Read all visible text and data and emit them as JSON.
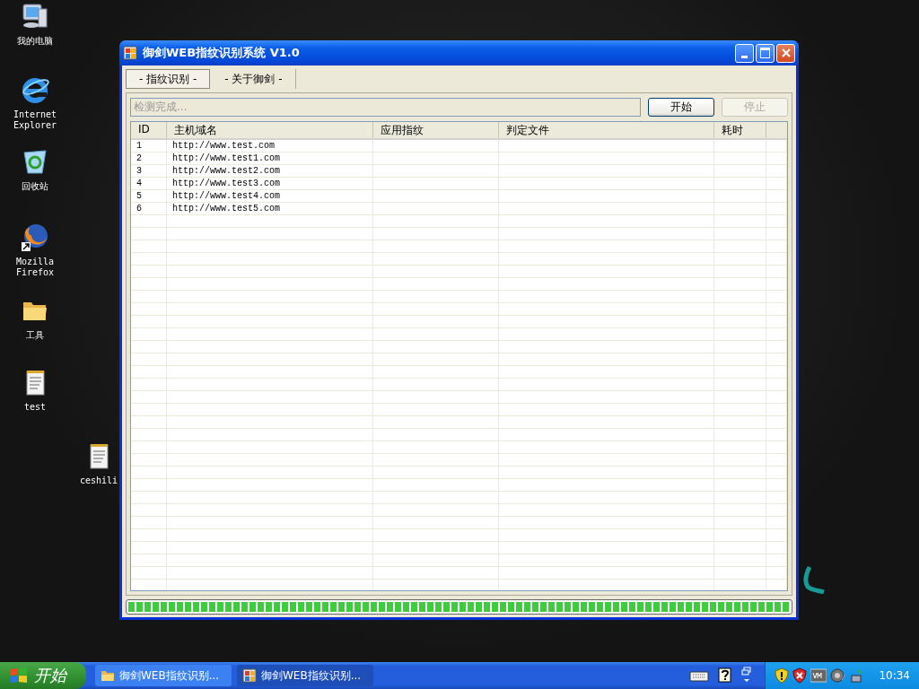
{
  "desktop_icons": [
    {
      "label": "我的电脑",
      "kind": "computer"
    },
    {
      "label": "Internet Explorer",
      "kind": "browser"
    },
    {
      "label": "回收站",
      "kind": "recycle"
    },
    {
      "label": "Mozilla Firefox",
      "kind": "firefox"
    },
    {
      "label": "工具",
      "kind": "folder"
    },
    {
      "label": "test",
      "kind": "notepad"
    },
    {
      "label": "ceshili",
      "kind": "notepad"
    }
  ],
  "window": {
    "title": "御剑WEB指纹识别系统 V1.0",
    "tabs": [
      {
        "label": "- 指纹识别 -",
        "selected": true
      },
      {
        "label": "- 关于御剑 -",
        "selected": false
      }
    ],
    "status_field": {
      "value": "检测完成..."
    },
    "buttons": [
      {
        "label": "开始",
        "disabled": false
      },
      {
        "label": "停止",
        "disabled": true
      }
    ],
    "table": {
      "columns": [
        "ID",
        "主机域名",
        "应用指纹",
        "判定文件",
        "耗时"
      ],
      "rows": [
        {
          "id": "1",
          "host": "http://www.test.com"
        },
        {
          "id": "2",
          "host": "http://www.test1.com"
        },
        {
          "id": "3",
          "host": "http://www.test2.com"
        },
        {
          "id": "4",
          "host": "http://www.test3.com"
        },
        {
          "id": "5",
          "host": "http://www.test4.com"
        },
        {
          "id": "6",
          "host": "http://www.test5.com"
        }
      ]
    },
    "progress": {
      "level": 1
    }
  },
  "taskbar": {
    "start_label": "开始",
    "tasks": [
      {
        "label": "御剑WEB指纹识别...",
        "kind": "folder",
        "selected": false
      },
      {
        "label": "御剑WEB指纹识别...",
        "kind": "app",
        "selected": true
      }
    ],
    "clock": "10:34"
  }
}
